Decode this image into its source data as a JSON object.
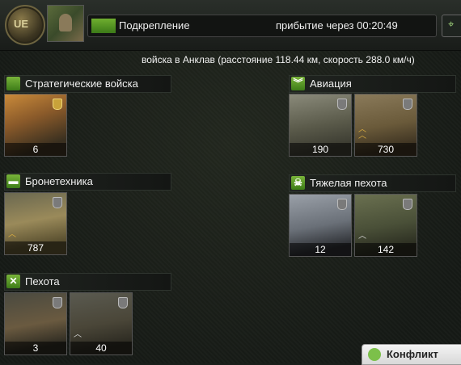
{
  "topbar": {
    "emblem_text": "UE",
    "reinforcement_label": "Подкрепление",
    "arrival_label": "прибытие через 00:20:49",
    "map_icon": "map-pin-icon"
  },
  "info_line": "войска в Анклав  (расстояние 118.44 км, скорость 288.0 км/ч)",
  "categories": {
    "strategic": {
      "title": "Стратегические войска",
      "icon": "strategic-icon",
      "units": [
        {
          "count": "6"
        }
      ]
    },
    "armor": {
      "title": "Бронетехника",
      "icon": "tank-icon",
      "units": [
        {
          "count": "787"
        }
      ]
    },
    "infantry": {
      "title": "Пехота",
      "icon": "crossed-rifles-icon",
      "units": [
        {
          "count": "3"
        },
        {
          "count": "40"
        }
      ]
    },
    "aviation": {
      "title": "Авиация",
      "icon": "wings-icon",
      "units": [
        {
          "count": "190"
        },
        {
          "count": "730"
        }
      ]
    },
    "heavy": {
      "title": "Тяжелая пехота",
      "icon": "skull-icon",
      "units": [
        {
          "count": "12"
        },
        {
          "count": "142"
        }
      ]
    }
  },
  "footer": {
    "label": "Конфликт",
    "icon": "chat-icon"
  },
  "colors": {
    "accent": "#5f9e2a",
    "gold": "#c9a23a"
  }
}
